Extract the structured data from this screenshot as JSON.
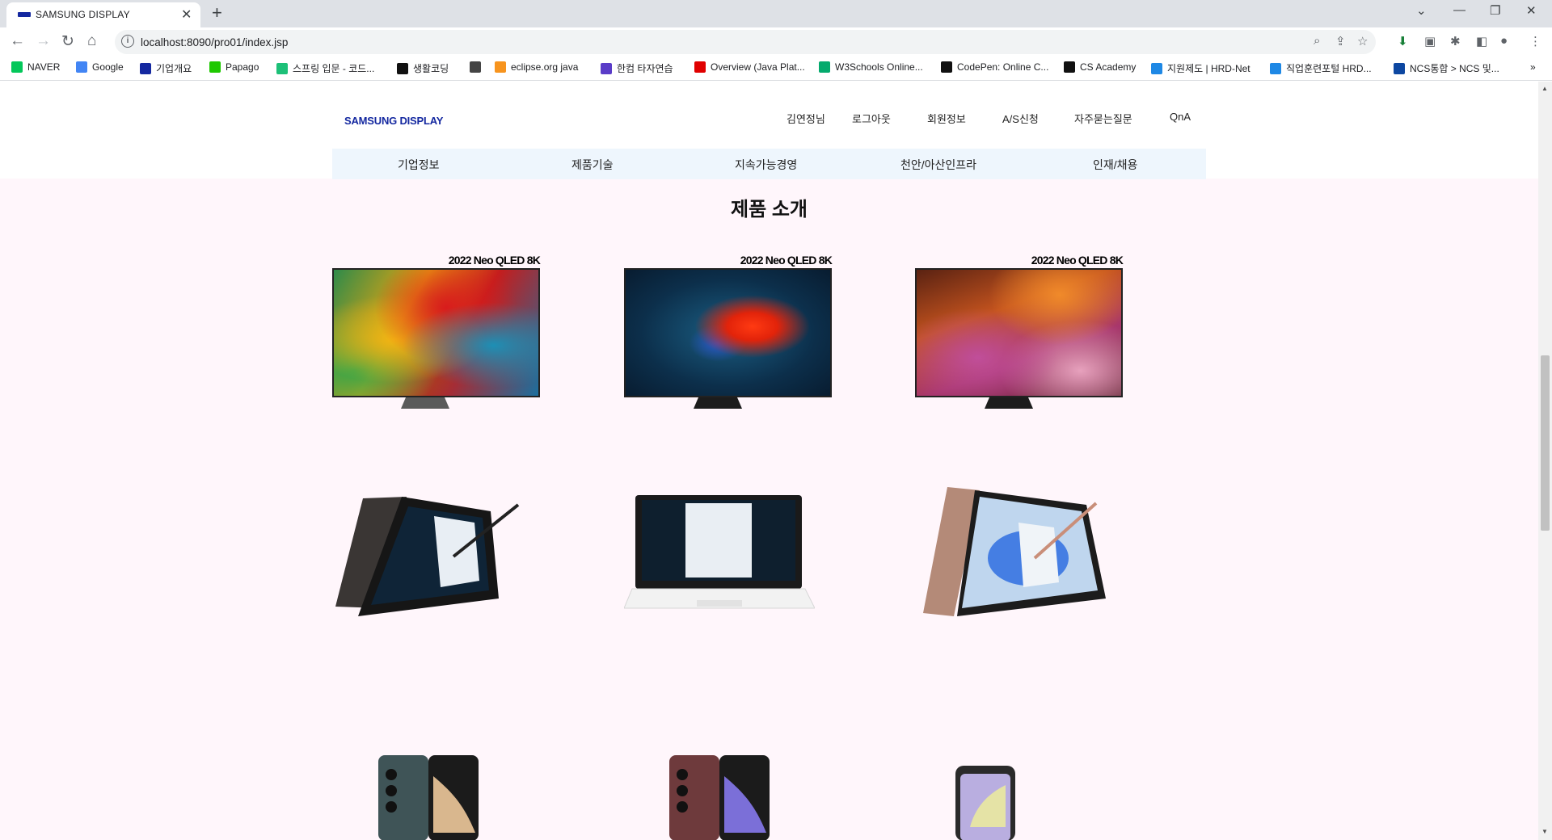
{
  "browser": {
    "tab_title": "SAMSUNG DISPLAY",
    "url": "localhost:8090/pro01/index.jsp",
    "bookmarks": [
      {
        "label": "NAVER",
        "icon": "naver-icon",
        "color": "#03c75a"
      },
      {
        "label": "Google",
        "icon": "google-icon",
        "color": "#4285f4"
      },
      {
        "label": "기업개요",
        "icon": "samsung-icon",
        "color": "#1428a0"
      },
      {
        "label": "Papago",
        "icon": "papago-icon",
        "color": "#1ec800"
      },
      {
        "label": "스프링 입문 - 코드...",
        "icon": "inflearn-icon",
        "color": "#1dc078"
      },
      {
        "label": "생활코딩",
        "icon": "opentutorials-icon",
        "color": "#111111"
      },
      {
        "label": "",
        "icon": "globe-icon",
        "color": "#444444"
      },
      {
        "label": "eclipse.org java",
        "icon": "eclipse-icon",
        "color": "#f7941e"
      },
      {
        "label": "한컴 타자연습",
        "icon": "hancom-icon",
        "color": "#5a3cc8"
      },
      {
        "label": "Overview (Java Plat...",
        "icon": "oracle-icon",
        "color": "#e00000"
      },
      {
        "label": "W3Schools Online...",
        "icon": "w3schools-icon",
        "color": "#04aa6d"
      },
      {
        "label": "CodePen: Online C...",
        "icon": "codepen-icon",
        "color": "#111111"
      },
      {
        "label": "CS Academy",
        "icon": "csacademy-icon",
        "color": "#111111"
      },
      {
        "label": "지원제도 | HRD-Net",
        "icon": "hrdnet-icon",
        "color": "#1e88e5"
      },
      {
        "label": "직업훈련포털 HRD...",
        "icon": "hrdnet-icon",
        "color": "#1e88e5"
      },
      {
        "label": "NCS통합 > NCS 및...",
        "icon": "ncs-icon",
        "color": "#0d47a1"
      }
    ]
  },
  "header": {
    "logo": "SAMSUNG DISPLAY",
    "user": "김연정님",
    "util_links": [
      "로그아웃",
      "회원정보",
      "A/S신청",
      "자주묻는질문",
      "QnA"
    ],
    "gnb": [
      "기업정보",
      "제품기술",
      "지속가능경영",
      "천안/아산인프라",
      "인재/채용"
    ]
  },
  "main": {
    "section_title": "제품 소개",
    "tv_products": [
      {
        "label": "2022 Neo QLED 8K",
        "image": "tv-parrot-feathers-image"
      },
      {
        "label": "2022 Neo QLED 8K",
        "image": "tv-betta-fish-image"
      },
      {
        "label": "2022 Neo QLED 8K",
        "image": "tv-antelope-canyon-image"
      }
    ],
    "laptop_products": [
      {
        "image": "galaxy-book-flip-graphite-image"
      },
      {
        "image": "galaxy-book-white-image"
      },
      {
        "image": "galaxy-book-flip-bronze-image"
      }
    ],
    "phone_products": [
      {
        "image": "galaxy-z-fold-green-image"
      },
      {
        "image": "galaxy-z-fold-burgundy-image"
      },
      {
        "image": "galaxy-z-flip-purple-image"
      }
    ]
  }
}
